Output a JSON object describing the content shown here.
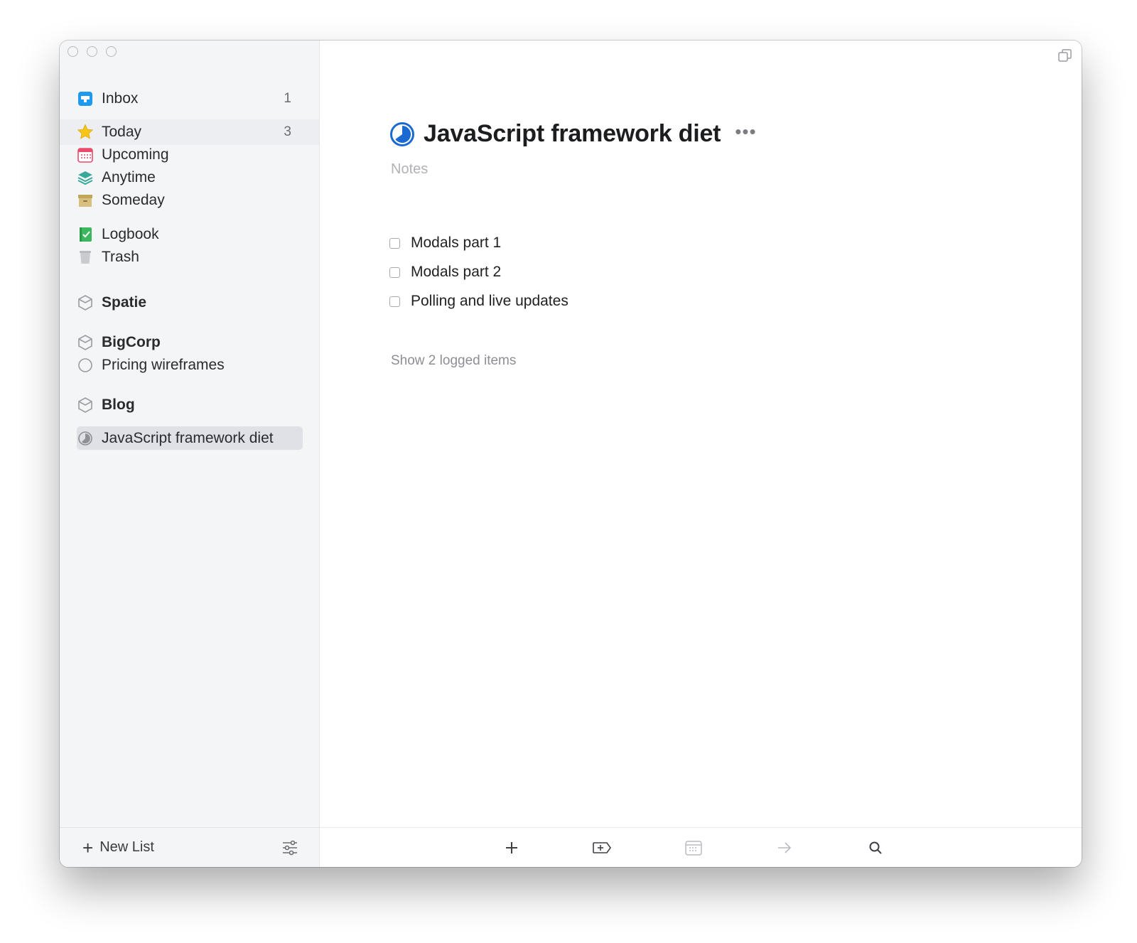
{
  "sidebar": {
    "items": {
      "inbox": {
        "label": "Inbox",
        "count": "1"
      },
      "today": {
        "label": "Today",
        "count": "3"
      },
      "upcoming": {
        "label": "Upcoming"
      },
      "anytime": {
        "label": "Anytime"
      },
      "someday": {
        "label": "Someday"
      },
      "logbook": {
        "label": "Logbook"
      },
      "trash": {
        "label": "Trash"
      }
    },
    "areas": {
      "spatie": {
        "label": "Spatie"
      },
      "bigcorp": {
        "label": "BigCorp",
        "projects": [
          "Pricing wireframes"
        ]
      },
      "blog": {
        "label": "Blog",
        "projects": [
          "JavaScript framework diet"
        ]
      }
    },
    "footer": {
      "new_list_label": "New List"
    }
  },
  "main": {
    "title": "JavaScript framework diet",
    "more_glyph": "•••",
    "notes_placeholder": "Notes",
    "todos": [
      "Modals part 1",
      "Modals part 2",
      "Polling and live updates"
    ],
    "show_logged": "Show 2 logged items"
  },
  "toolbar": {
    "buttons": [
      "add-todo",
      "add-heading",
      "when",
      "move",
      "search"
    ]
  },
  "colors": {
    "accent_blue": "#1b6ad2",
    "inbox_blue": "#1e9bef",
    "today_yellow": "#f5c518",
    "upcoming_red": "#e94b6a",
    "anytime_teal": "#3aa89a",
    "someday_tan": "#d0b46a",
    "logbook_green": "#3db75e"
  }
}
